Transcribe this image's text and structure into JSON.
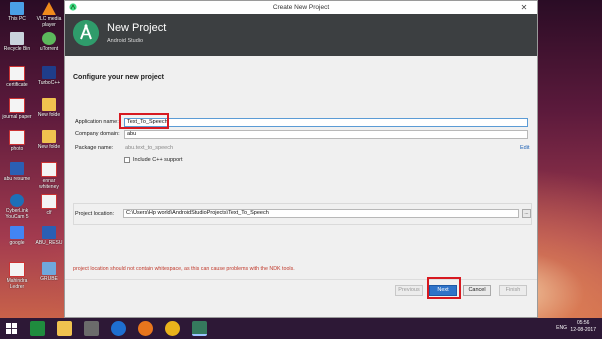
{
  "desktop": {
    "icons": [
      {
        "label": "This PC"
      },
      {
        "label": "VLC media player"
      },
      {
        "label": "Recycle Bin"
      },
      {
        "label": "uTorrent"
      },
      {
        "label": "certificate"
      },
      {
        "label": "TurboC++"
      },
      {
        "label": "journal paper"
      },
      {
        "label": "New folde"
      },
      {
        "label": "photo"
      },
      {
        "label": "New folde"
      },
      {
        "label": "abu resume"
      },
      {
        "label": "ennar whiteney"
      },
      {
        "label": "CyberLink YouCam 5"
      },
      {
        "label": "clf"
      },
      {
        "label": "google"
      },
      {
        "label": "ABU_RESU"
      },
      {
        "label": "Mahindra Ledrer"
      },
      {
        "label": "GRUBE"
      }
    ],
    "wallpaper_brand": "bing"
  },
  "window": {
    "title": "Create New Project",
    "close_glyph": "✕",
    "banner": {
      "title": "New Project",
      "subtitle": "Android Studio"
    },
    "section_heading": "Configure your new project",
    "fields": {
      "application_name_label": "Application name:",
      "application_name_value": "Text_To_Speech",
      "company_domain_label": "Company domain:",
      "company_domain_value": "abu",
      "package_name_label": "Package name:",
      "package_name_value": "abu.text_to_speech",
      "edit_link": "Edit",
      "cpp_support_label": "Include C++ support",
      "project_location_label": "Project location:",
      "project_location_value": "C:\\Users\\Hp world\\AndroidStudioProjects\\Text_To_Speech",
      "browse_label": "..."
    },
    "error_message": "project location should not contain whitespace, as this can cause problems with the NDK tools.",
    "buttons": {
      "previous": "Previous",
      "next": "Next",
      "cancel": "Cancel",
      "finish": "Finish"
    }
  },
  "taskbar": {
    "language": "ENG",
    "time": "05:56",
    "date": "12-08-2017"
  },
  "colors": {
    "banner": "#3c3f41",
    "primary_button": "#2f73c9",
    "error": "#c0392b",
    "highlight_box": "#d71920"
  }
}
